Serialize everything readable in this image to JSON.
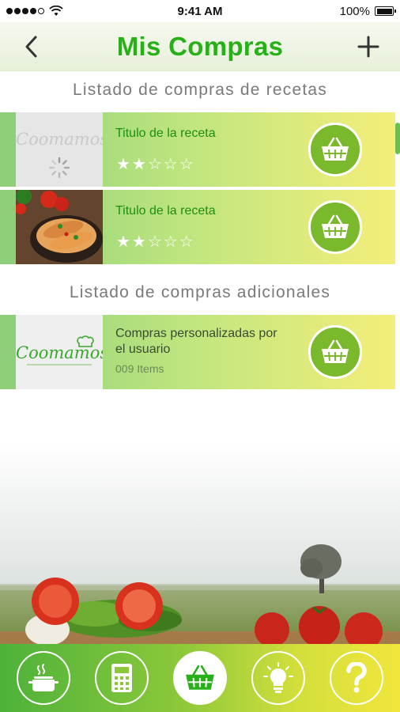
{
  "status_bar": {
    "time": "9:41 AM",
    "battery": "100%"
  },
  "header": {
    "title": "Mis Compras"
  },
  "sections": {
    "recipes_title": "Listado de compras de recetas",
    "additional_title": "Listado de compras adicionales"
  },
  "recipe_items": [
    {
      "title": "Titulo de la receta",
      "rating": 2,
      "max_rating": 5
    },
    {
      "title": "Titulo de la receta",
      "rating": 2,
      "max_rating": 5
    }
  ],
  "additional_items": [
    {
      "title": "Compras personalizadas por el usuario",
      "count": "009 Items"
    }
  ],
  "logo": {
    "text": "Coomamos"
  },
  "bottom_nav": [
    {
      "name": "pot-icon",
      "active": false
    },
    {
      "name": "calculator-icon",
      "active": false
    },
    {
      "name": "basket-icon",
      "active": true
    },
    {
      "name": "lightbulb-icon",
      "active": false
    },
    {
      "name": "help-icon",
      "active": false
    }
  ],
  "colors": {
    "accent": "#27b018",
    "basket": "#7ab82c"
  }
}
